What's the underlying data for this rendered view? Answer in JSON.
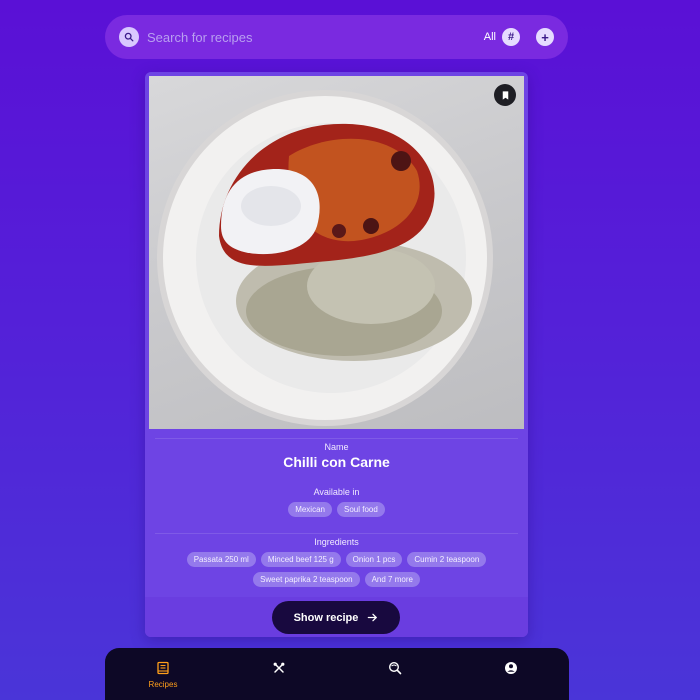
{
  "search": {
    "placeholder": "Search for recipes",
    "filter_label": "All",
    "filter_icon": "hash-icon",
    "add_icon": "plus-icon"
  },
  "recipe": {
    "name_label": "Name",
    "name": "Chilli con Carne",
    "available_label": "Available in",
    "cuisines": [
      "Mexican",
      "Soul food"
    ],
    "ingredients_label": "Ingredients",
    "ingredients": [
      "Passata 250 ml",
      "Minced beef 125 g",
      "Onion 1 pcs",
      "Cumin 2 teaspoon",
      "Sweet paprika 2 teaspoon",
      "And 7 more"
    ],
    "show_button": "Show recipe"
  },
  "nav": {
    "items": [
      {
        "label": "Recipes",
        "icon": "book-icon",
        "active": true
      },
      {
        "label": "",
        "icon": "utensils-icon",
        "active": false
      },
      {
        "label": "",
        "icon": "search-globe-icon",
        "active": false
      },
      {
        "label": "",
        "icon": "user-icon",
        "active": false
      }
    ]
  },
  "colors": {
    "accent_active": "#ff9f1a",
    "card": "#6e44e4",
    "nav_bg": "#0d0826"
  }
}
